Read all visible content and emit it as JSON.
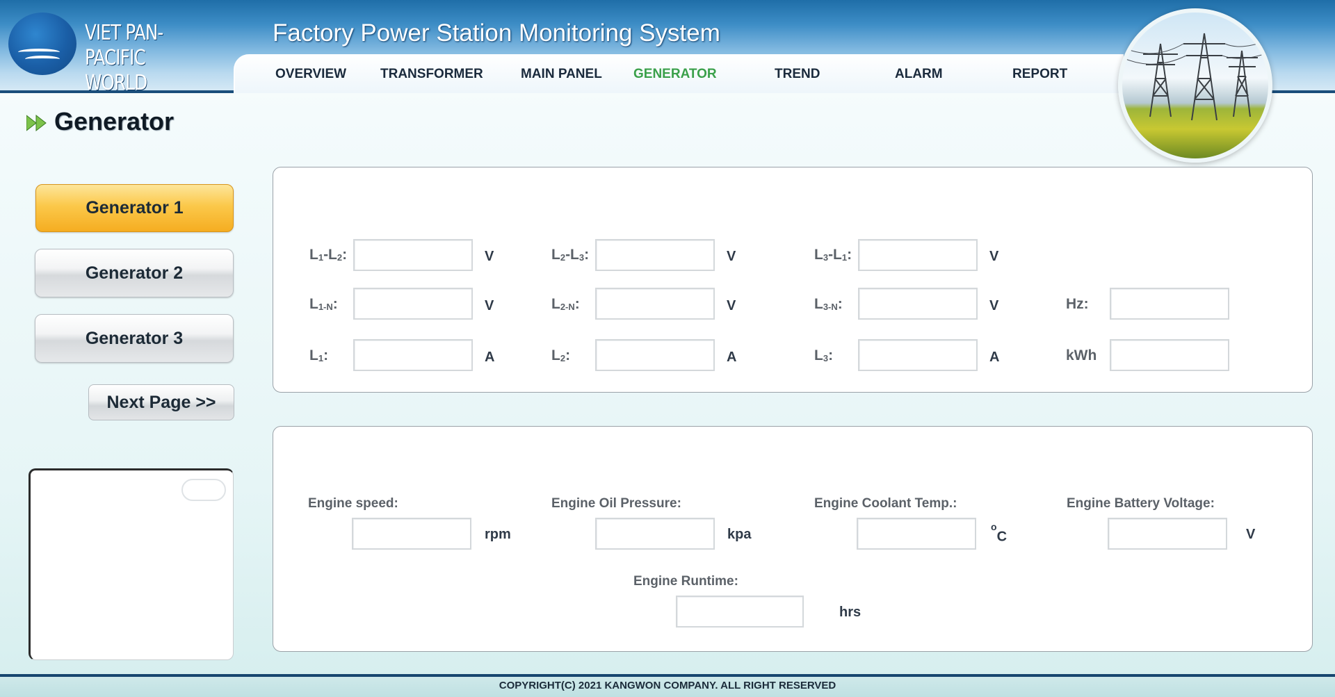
{
  "logo": {
    "line1": "VIET PAN-PACIFIC",
    "line2": "WORLD"
  },
  "app_title": "Factory Power Station Monitoring System",
  "nav": {
    "items": [
      {
        "label": "OVERVIEW"
      },
      {
        "label": "TRANSFORMER"
      },
      {
        "label": "MAIN PANEL"
      },
      {
        "label": "GENERATOR"
      },
      {
        "label": "TREND"
      },
      {
        "label": "ALARM"
      },
      {
        "label": "REPORT"
      }
    ],
    "active": "GENERATOR",
    "active_color": "#3aa04a"
  },
  "page_title": "Generator",
  "sidebar": {
    "buttons": [
      {
        "label": "Generator 1"
      },
      {
        "label": "Generator 2"
      },
      {
        "label": "Generator 3"
      }
    ],
    "active": "Generator 1",
    "next_page_label": "Next Page >>"
  },
  "electrical": {
    "l1l2": {
      "label_a": "L",
      "sub_a": "1",
      "label_b": "-L",
      "sub_b": "2",
      "suffix": ":",
      "unit": "V",
      "value": ""
    },
    "l2l3": {
      "label_a": "L",
      "sub_a": "2",
      "label_b": "-L",
      "sub_b": "3",
      "suffix": ":",
      "unit": "V",
      "value": ""
    },
    "l3l1": {
      "label_a": "L",
      "sub_a": "3",
      "label_b": "-L",
      "sub_b": "1",
      "suffix": ":",
      "unit": "V",
      "value": ""
    },
    "l1n": {
      "label_a": "L",
      "sub_a": "1-N",
      "suffix": ":",
      "unit": "V",
      "value": ""
    },
    "l2n": {
      "label_a": "L",
      "sub_a": "2-N",
      "suffix": ":",
      "unit": "V",
      "value": ""
    },
    "l3n": {
      "label_a": "L",
      "sub_a": "3-N",
      "suffix": ":",
      "unit": "V",
      "value": ""
    },
    "hz": {
      "label": "Hz:",
      "value": ""
    },
    "l1": {
      "label_a": "L",
      "sub_a": "1",
      "suffix": ":",
      "unit": "A",
      "value": ""
    },
    "l2": {
      "label_a": "L",
      "sub_a": "2",
      "suffix": ":",
      "unit": "A",
      "value": ""
    },
    "l3": {
      "label_a": "L",
      "sub_a": "3",
      "suffix": ":",
      "unit": "A",
      "value": ""
    },
    "kwh": {
      "label": "kWh",
      "value": ""
    }
  },
  "engine": {
    "speed": {
      "label": "Engine speed:",
      "unit": "rpm",
      "value": ""
    },
    "oil_pressure": {
      "label": "Engine Oil Pressure:",
      "unit": "kpa",
      "value": ""
    },
    "coolant_temp": {
      "label": "Engine Coolant Temp.:",
      "unit_sup": "o",
      "unit": "C",
      "value": ""
    },
    "battery_voltage": {
      "label": "Engine Battery Voltage:",
      "unit": "V",
      "value": ""
    },
    "runtime": {
      "label": "Engine Runtime:",
      "unit": "hrs",
      "value": ""
    }
  },
  "footer": "COPYRIGHT(C) 2021 KANGWON COMPANY. ALL RIGHT RESERVED"
}
